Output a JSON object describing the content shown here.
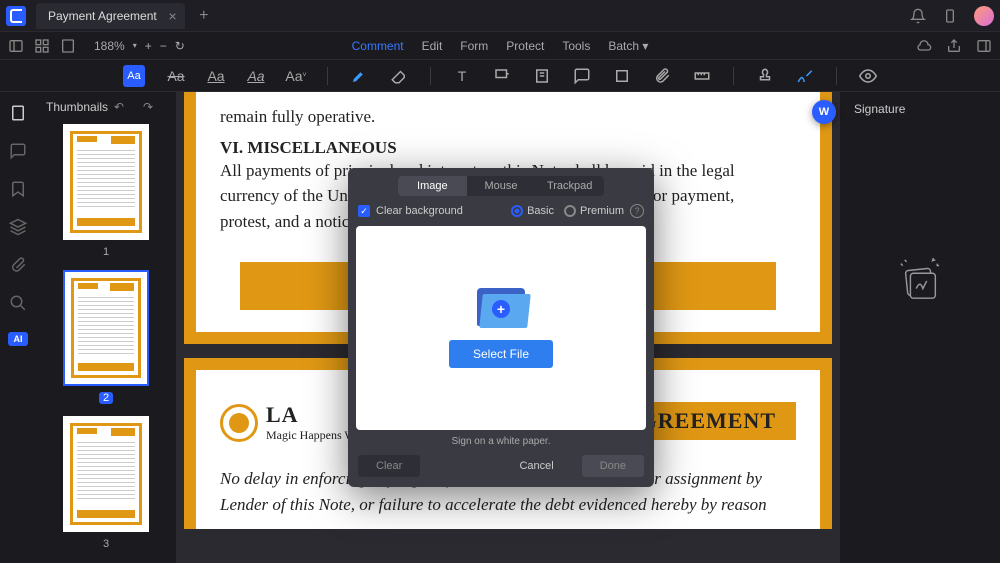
{
  "titlebar": {
    "tab_title": "Payment Agreement"
  },
  "toolbar": {
    "zoom": "188%",
    "menu": [
      "Comment",
      "Edit",
      "Form",
      "Protect",
      "Tools",
      "Batch"
    ],
    "menu_active_index": 0
  },
  "thumbnails": {
    "title": "Thumbnails",
    "pages": [
      "1",
      "2",
      "3"
    ],
    "selected_index": 1
  },
  "document": {
    "page1": {
      "l1": "remain fully operative.",
      "h1": "VI. MISCELLANEOUS",
      "l2": "All payments of principal and interest on this Note shall be paid in the legal",
      "l3": "currency of the United States. The Debtor waives presentment for payment,",
      "l4": "protest, and a notice of protest and demand of this Note."
    },
    "page2": {
      "brand_partial": "LA",
      "tagline": "Magic Happens With Content",
      "tag": "GREEMENT",
      "l1": "No delay in enforcing any right of the Lender under this Note, or assignment by",
      "l2": "Lender of this Note, or failure to accelerate the debt evidenced hereby by reason"
    }
  },
  "right_panel": {
    "title": "Signature"
  },
  "chip": "W",
  "modal": {
    "segments": [
      "Image",
      "Mouse",
      "Trackpad"
    ],
    "segment_selected_index": 0,
    "clear_bg_label": "Clear background",
    "radio_basic": "Basic",
    "radio_premium": "Premium",
    "select_file": "Select File",
    "hint": "Sign on a white paper.",
    "btn_clear": "Clear",
    "btn_cancel": "Cancel",
    "btn_done": "Done"
  }
}
